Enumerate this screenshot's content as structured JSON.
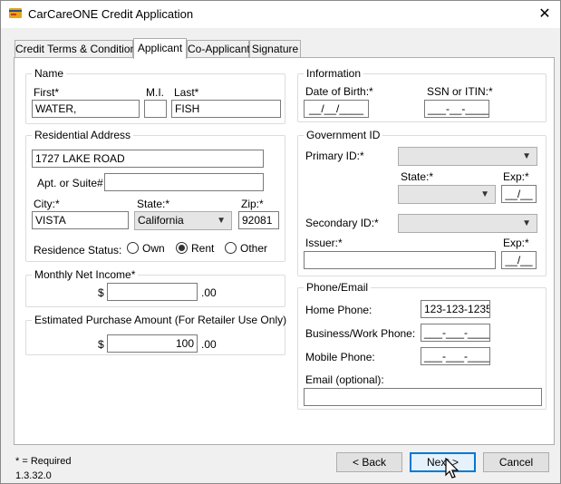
{
  "window": {
    "title": "CarCareONE Credit Application",
    "close_glyph": "✕"
  },
  "tabs": [
    {
      "label": "Credit Terms & Conditions",
      "active": false
    },
    {
      "label": "Applicant",
      "active": true
    },
    {
      "label": "Co-Applicant",
      "active": false
    },
    {
      "label": "Signature",
      "active": false
    }
  ],
  "name": {
    "group_label": "Name",
    "first_label": "First*",
    "mi_label": "M.I.",
    "last_label": "Last*",
    "first_value": "WATER,",
    "mi_value": "",
    "last_value": "FISH"
  },
  "address": {
    "group_label": "Residential Address",
    "street_value": "1727 LAKE ROAD",
    "apt_label": "Apt. or Suite#",
    "apt_value": "",
    "city_label": "City:*",
    "state_label": "State:*",
    "zip_label": "Zip:*",
    "city_value": "VISTA",
    "state_value": "California",
    "zip_value": "92081",
    "status_label": "Residence Status:",
    "status_options": [
      "Own",
      "Rent",
      "Other"
    ],
    "status_selected": "Rent"
  },
  "income": {
    "group_label": "Monthly Net Income*",
    "currency": "$",
    "value": "",
    "cents": ".00"
  },
  "purchase": {
    "group_label": "Estimated Purchase Amount (For Retailer Use Only)",
    "currency": "$",
    "value": "100",
    "cents": ".00"
  },
  "information": {
    "group_label": "Information",
    "dob_label": "Date of Birth:*",
    "dob_value": "__/__/____",
    "ssn_label": "SSN or ITIN:*",
    "ssn_value": "___-__-____"
  },
  "government_id": {
    "group_label": "Government ID",
    "primary_label": "Primary ID:*",
    "primary_value": "",
    "state_label": "State:*",
    "state_value": "",
    "exp_label": "Exp:*",
    "exp1_value": "__/__",
    "secondary_label": "Secondary ID:*",
    "secondary_value": "",
    "issuer_label": "Issuer:*",
    "issuer_value": "",
    "exp2_value": "__/__"
  },
  "phone_email": {
    "group_label": "Phone/Email",
    "home_label": "Home Phone:",
    "home_value": "123-123-1235",
    "work_label": "Business/Work Phone:",
    "work_value": "___-___-____",
    "mobile_label": "Mobile Phone:",
    "mobile_value": "___-___-____",
    "email_label": "Email (optional):",
    "email_value": ""
  },
  "footer": {
    "required_note": "* = Required",
    "version": "1.3.32.0",
    "back_label": "< Back",
    "next_label": "Next >",
    "cancel_label": "Cancel"
  },
  "icons": {
    "app": "credit-card-icon",
    "close": "close-icon",
    "dropdown": "chevron-down-icon",
    "cursor": "mouse-pointer-icon"
  },
  "colors": {
    "accent": "#0078d7",
    "panel": "#ffffff",
    "chrome": "#f0f0f0"
  }
}
